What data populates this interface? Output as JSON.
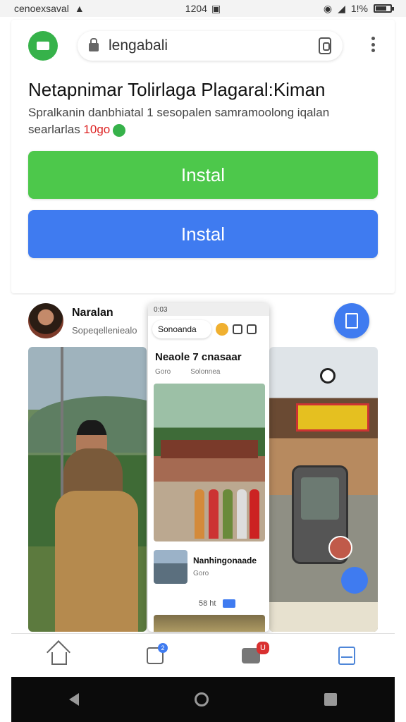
{
  "status_bar": {
    "carrier": "cenoexsaval",
    "time": "1204",
    "battery_text": "1!%"
  },
  "browser": {
    "url": "lengabali",
    "title": "Netapnimar Tolirlaga Plagaral:Kiman",
    "subtitle_line1": "Spralkanin danbhiatal 1 sesopalen samramoolong iqalan",
    "subtitle_line2_prefix": "searlarlas ",
    "subtitle_line2_red": "10go",
    "buttons": {
      "install_green": "Instal",
      "install_blue": "Instal"
    }
  },
  "feed": {
    "author": "Naralan",
    "author_sub": "Sopeqelleniealo",
    "overlay": {
      "status": "0:03",
      "url": "Sonoanda",
      "title": "Neaole 7 cnasaar",
      "sub_left": "Goro",
      "sub_right": "Solonnea",
      "row_title": "Nanhingonaade",
      "row_sub": "Goro",
      "meta": "58 ht"
    }
  },
  "bottom_nav": {
    "notification_badge": "U",
    "edit_badge": "2"
  },
  "colors": {
    "green": "#4dc84b",
    "blue": "#3f7bf0",
    "accent_red": "#d22222"
  },
  "icons": [
    "home-icon",
    "edit-icon",
    "people-icon",
    "panel-icon",
    "lock-icon",
    "tab-icon",
    "kebab-icon",
    "back-icon",
    "home-circle-icon",
    "recents-icon"
  ]
}
